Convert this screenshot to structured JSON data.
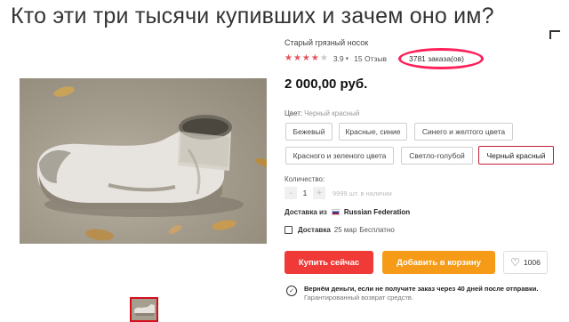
{
  "caption": "Кто эти три тысячи купивших и зачем оно им?",
  "product": {
    "title": "Старый грязный носок",
    "rating": "3.9",
    "stars_filled": 4,
    "reviews": "15 Отзыв",
    "orders": "3781 заказа(ов)",
    "price": "2 000,00 руб."
  },
  "color": {
    "label": "Цвет:",
    "current": "Черный красный",
    "options": [
      "Бежевый",
      "Красные, синие",
      "Синего и желтого цвета",
      "Красного и зеленого цвета",
      "Светло-голубой",
      "Черный красный"
    ],
    "selected_index": 5
  },
  "quantity": {
    "label": "Количество:",
    "minus": "-",
    "value": "1",
    "plus": "+",
    "stock": "9999 шт. в наличии"
  },
  "shipping": {
    "from_label": "Доставка из",
    "country": "Russian Federation",
    "delivery_label": "Доставка",
    "date": "25 мар",
    "cost": "Бесплатно"
  },
  "actions": {
    "buy": "Купить сейчас",
    "cart": "Добавить в корзину",
    "wishlist_count": "1006"
  },
  "guarantee": {
    "line1": "Вернём деньги, если не получите заказ через 40 дней после отправки.",
    "line2": "Гарантированный возврат средств."
  },
  "colors": {
    "buy_button": "#ef3a37",
    "cart_button": "#f59b18",
    "orders_circle": "#ff1f5a",
    "selected_chip": "#c21f3a",
    "star": "#e8525a"
  },
  "icons": {
    "wishlist": "heart-icon",
    "delivery": "truck-icon",
    "guarantee": "shield-check-icon",
    "flag": "russia-flag-icon"
  }
}
